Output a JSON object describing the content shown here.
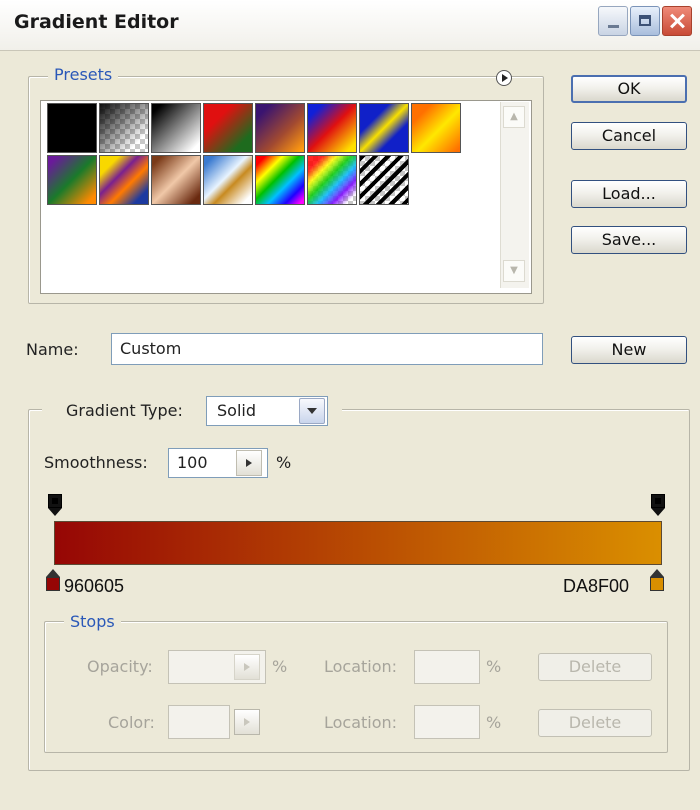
{
  "window": {
    "title": "Gradient Editor"
  },
  "presets": {
    "legend": "Presets",
    "swatches_row1": [
      "black",
      "transparent-checker",
      "black-to-white",
      "red-to-green",
      "violet-to-orange",
      "blue-red-yellow",
      "blue-yellow-blue",
      "orange-yellow-orange"
    ],
    "swatches_row2": [
      "violet-green-orange",
      "yellow-violet-orange-blue",
      "copper",
      "chrome",
      "spectrum",
      "transparent-rainbow",
      "transparent-stripes"
    ]
  },
  "buttons": {
    "ok": "OK",
    "cancel": "Cancel",
    "load": "Load...",
    "save": "Save...",
    "new": "New"
  },
  "name": {
    "label": "Name:",
    "value": "Custom"
  },
  "gradient": {
    "type_label": "Gradient Type:",
    "type_value": "Solid",
    "smoothness_label": "Smoothness:",
    "smoothness_value": "100",
    "percent": "%",
    "start_color_label": "960605",
    "end_color_label": "DA8F00",
    "colors": {
      "start": "#960605",
      "end": "#DA8F00"
    }
  },
  "stops": {
    "legend": "Stops",
    "opacity_label": "Opacity:",
    "color_label": "Color:",
    "location_label": "Location:",
    "percent": "%",
    "delete": "Delete"
  }
}
